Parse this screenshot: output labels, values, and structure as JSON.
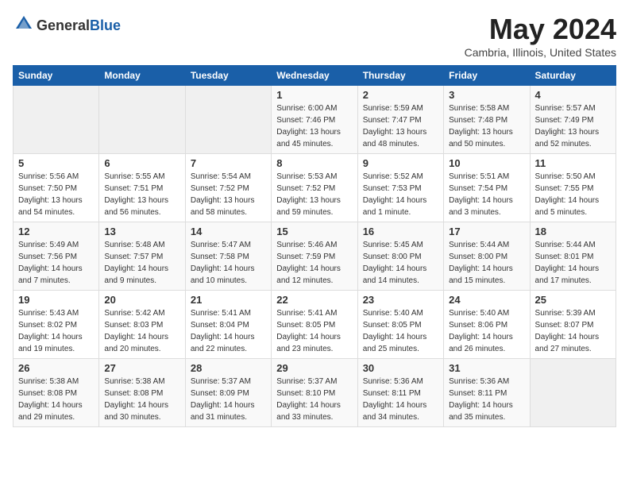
{
  "header": {
    "logo_general": "General",
    "logo_blue": "Blue",
    "month_title": "May 2024",
    "location": "Cambria, Illinois, United States"
  },
  "days_of_week": [
    "Sunday",
    "Monday",
    "Tuesday",
    "Wednesday",
    "Thursday",
    "Friday",
    "Saturday"
  ],
  "weeks": [
    [
      {
        "day": "",
        "info": ""
      },
      {
        "day": "",
        "info": ""
      },
      {
        "day": "",
        "info": ""
      },
      {
        "day": "1",
        "sunrise": "Sunrise: 6:00 AM",
        "sunset": "Sunset: 7:46 PM",
        "daylight": "Daylight: 13 hours and 45 minutes."
      },
      {
        "day": "2",
        "sunrise": "Sunrise: 5:59 AM",
        "sunset": "Sunset: 7:47 PM",
        "daylight": "Daylight: 13 hours and 48 minutes."
      },
      {
        "day": "3",
        "sunrise": "Sunrise: 5:58 AM",
        "sunset": "Sunset: 7:48 PM",
        "daylight": "Daylight: 13 hours and 50 minutes."
      },
      {
        "day": "4",
        "sunrise": "Sunrise: 5:57 AM",
        "sunset": "Sunset: 7:49 PM",
        "daylight": "Daylight: 13 hours and 52 minutes."
      }
    ],
    [
      {
        "day": "5",
        "sunrise": "Sunrise: 5:56 AM",
        "sunset": "Sunset: 7:50 PM",
        "daylight": "Daylight: 13 hours and 54 minutes."
      },
      {
        "day": "6",
        "sunrise": "Sunrise: 5:55 AM",
        "sunset": "Sunset: 7:51 PM",
        "daylight": "Daylight: 13 hours and 56 minutes."
      },
      {
        "day": "7",
        "sunrise": "Sunrise: 5:54 AM",
        "sunset": "Sunset: 7:52 PM",
        "daylight": "Daylight: 13 hours and 58 minutes."
      },
      {
        "day": "8",
        "sunrise": "Sunrise: 5:53 AM",
        "sunset": "Sunset: 7:52 PM",
        "daylight": "Daylight: 13 hours and 59 minutes."
      },
      {
        "day": "9",
        "sunrise": "Sunrise: 5:52 AM",
        "sunset": "Sunset: 7:53 PM",
        "daylight": "Daylight: 14 hours and 1 minute."
      },
      {
        "day": "10",
        "sunrise": "Sunrise: 5:51 AM",
        "sunset": "Sunset: 7:54 PM",
        "daylight": "Daylight: 14 hours and 3 minutes."
      },
      {
        "day": "11",
        "sunrise": "Sunrise: 5:50 AM",
        "sunset": "Sunset: 7:55 PM",
        "daylight": "Daylight: 14 hours and 5 minutes."
      }
    ],
    [
      {
        "day": "12",
        "sunrise": "Sunrise: 5:49 AM",
        "sunset": "Sunset: 7:56 PM",
        "daylight": "Daylight: 14 hours and 7 minutes."
      },
      {
        "day": "13",
        "sunrise": "Sunrise: 5:48 AM",
        "sunset": "Sunset: 7:57 PM",
        "daylight": "Daylight: 14 hours and 9 minutes."
      },
      {
        "day": "14",
        "sunrise": "Sunrise: 5:47 AM",
        "sunset": "Sunset: 7:58 PM",
        "daylight": "Daylight: 14 hours and 10 minutes."
      },
      {
        "day": "15",
        "sunrise": "Sunrise: 5:46 AM",
        "sunset": "Sunset: 7:59 PM",
        "daylight": "Daylight: 14 hours and 12 minutes."
      },
      {
        "day": "16",
        "sunrise": "Sunrise: 5:45 AM",
        "sunset": "Sunset: 8:00 PM",
        "daylight": "Daylight: 14 hours and 14 minutes."
      },
      {
        "day": "17",
        "sunrise": "Sunrise: 5:44 AM",
        "sunset": "Sunset: 8:00 PM",
        "daylight": "Daylight: 14 hours and 15 minutes."
      },
      {
        "day": "18",
        "sunrise": "Sunrise: 5:44 AM",
        "sunset": "Sunset: 8:01 PM",
        "daylight": "Daylight: 14 hours and 17 minutes."
      }
    ],
    [
      {
        "day": "19",
        "sunrise": "Sunrise: 5:43 AM",
        "sunset": "Sunset: 8:02 PM",
        "daylight": "Daylight: 14 hours and 19 minutes."
      },
      {
        "day": "20",
        "sunrise": "Sunrise: 5:42 AM",
        "sunset": "Sunset: 8:03 PM",
        "daylight": "Daylight: 14 hours and 20 minutes."
      },
      {
        "day": "21",
        "sunrise": "Sunrise: 5:41 AM",
        "sunset": "Sunset: 8:04 PM",
        "daylight": "Daylight: 14 hours and 22 minutes."
      },
      {
        "day": "22",
        "sunrise": "Sunrise: 5:41 AM",
        "sunset": "Sunset: 8:05 PM",
        "daylight": "Daylight: 14 hours and 23 minutes."
      },
      {
        "day": "23",
        "sunrise": "Sunrise: 5:40 AM",
        "sunset": "Sunset: 8:05 PM",
        "daylight": "Daylight: 14 hours and 25 minutes."
      },
      {
        "day": "24",
        "sunrise": "Sunrise: 5:40 AM",
        "sunset": "Sunset: 8:06 PM",
        "daylight": "Daylight: 14 hours and 26 minutes."
      },
      {
        "day": "25",
        "sunrise": "Sunrise: 5:39 AM",
        "sunset": "Sunset: 8:07 PM",
        "daylight": "Daylight: 14 hours and 27 minutes."
      }
    ],
    [
      {
        "day": "26",
        "sunrise": "Sunrise: 5:38 AM",
        "sunset": "Sunset: 8:08 PM",
        "daylight": "Daylight: 14 hours and 29 minutes."
      },
      {
        "day": "27",
        "sunrise": "Sunrise: 5:38 AM",
        "sunset": "Sunset: 8:08 PM",
        "daylight": "Daylight: 14 hours and 30 minutes."
      },
      {
        "day": "28",
        "sunrise": "Sunrise: 5:37 AM",
        "sunset": "Sunset: 8:09 PM",
        "daylight": "Daylight: 14 hours and 31 minutes."
      },
      {
        "day": "29",
        "sunrise": "Sunrise: 5:37 AM",
        "sunset": "Sunset: 8:10 PM",
        "daylight": "Daylight: 14 hours and 33 minutes."
      },
      {
        "day": "30",
        "sunrise": "Sunrise: 5:36 AM",
        "sunset": "Sunset: 8:11 PM",
        "daylight": "Daylight: 14 hours and 34 minutes."
      },
      {
        "day": "31",
        "sunrise": "Sunrise: 5:36 AM",
        "sunset": "Sunset: 8:11 PM",
        "daylight": "Daylight: 14 hours and 35 minutes."
      },
      {
        "day": "",
        "info": ""
      }
    ]
  ]
}
